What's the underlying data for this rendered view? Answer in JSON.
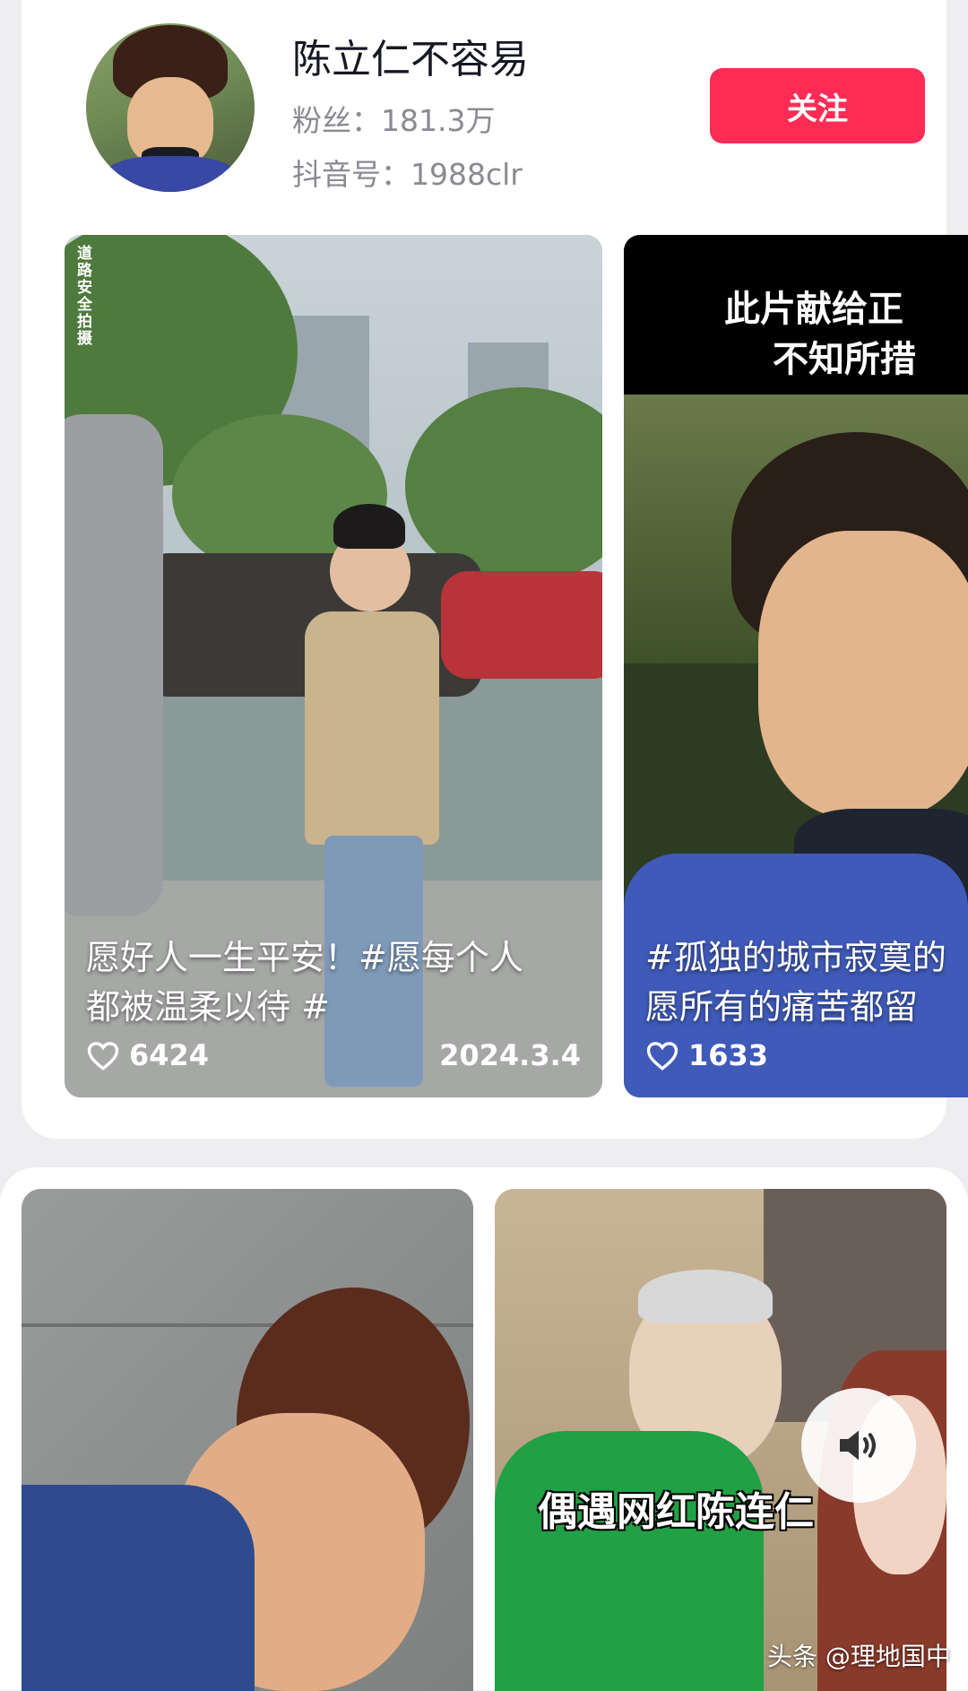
{
  "profile": {
    "name": "陈立仁不容易",
    "fans": "粉丝：181.3万",
    "douyin_id": "抖音号：1988clr",
    "follow_label": "关注"
  },
  "videos": [
    {
      "watermark_vertical": "道路安全拍摄",
      "caption_line1": "愿好人一生平安！#愿每个人",
      "caption_line2": "都被温柔以待 #",
      "likes": "6424",
      "date": "2024.3.4"
    },
    {
      "banner_line1": "此片献给正",
      "banner_line2": "不知所措",
      "caption_line1": "#孤独的城市寂寞的",
      "caption_line2": "愿所有的痛苦都留",
      "likes": "1633"
    },
    {},
    {
      "overlay_text": "偶遇网红陈连仁"
    }
  ],
  "footer": {
    "watermark": "头条 @理地国中"
  },
  "colors": {
    "follow_button": "#fe2c55",
    "background": "#eeeef0"
  },
  "icons": [
    "heart-icon",
    "speaker-icon"
  ]
}
